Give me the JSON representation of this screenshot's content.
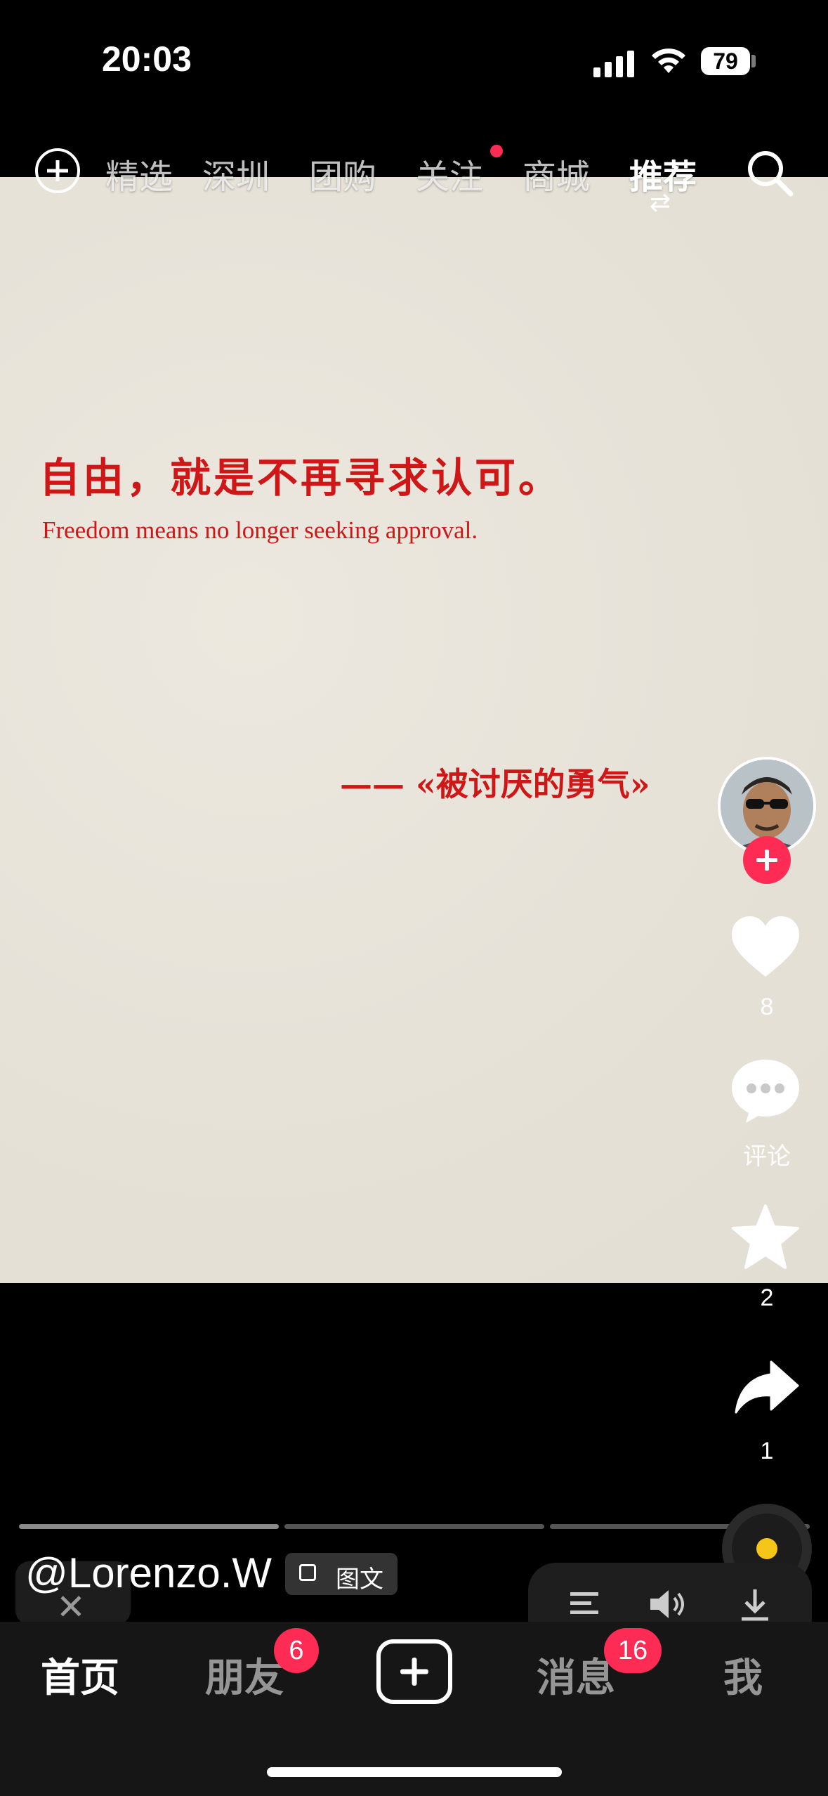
{
  "status_bar": {
    "time": "20:03",
    "battery": "79"
  },
  "top_nav": {
    "tabs": [
      {
        "label": "精选"
      },
      {
        "label": "深圳"
      },
      {
        "label": "团购"
      },
      {
        "label": "关注"
      },
      {
        "label": "商城"
      },
      {
        "label": "推荐"
      }
    ],
    "active_tab": "推荐",
    "swap_glyph": "⇄"
  },
  "content": {
    "quote_zh": "自由，就是不再寻求认可。",
    "quote_en": "Freedom means no longer seeking approval.",
    "source": "—— «被讨厌的勇气»"
  },
  "sidebar": {
    "like_count": "8",
    "comment_label": "评论",
    "favorite_count": "2",
    "share_count": "1"
  },
  "progress": {
    "segments": 3,
    "current": 1
  },
  "caption": {
    "author": "@Lorenzo.W",
    "type_badge": "图文"
  },
  "bottom_nav": {
    "items": [
      {
        "label": "首页"
      },
      {
        "label": "朋友"
      },
      {
        "label": "消息"
      },
      {
        "label": "我"
      }
    ],
    "friends_badge": "6",
    "messages_badge": "16"
  },
  "colors": {
    "accent": "#fe2c55",
    "quote_red": "#cf1717",
    "music_dot": "#f5c518"
  }
}
